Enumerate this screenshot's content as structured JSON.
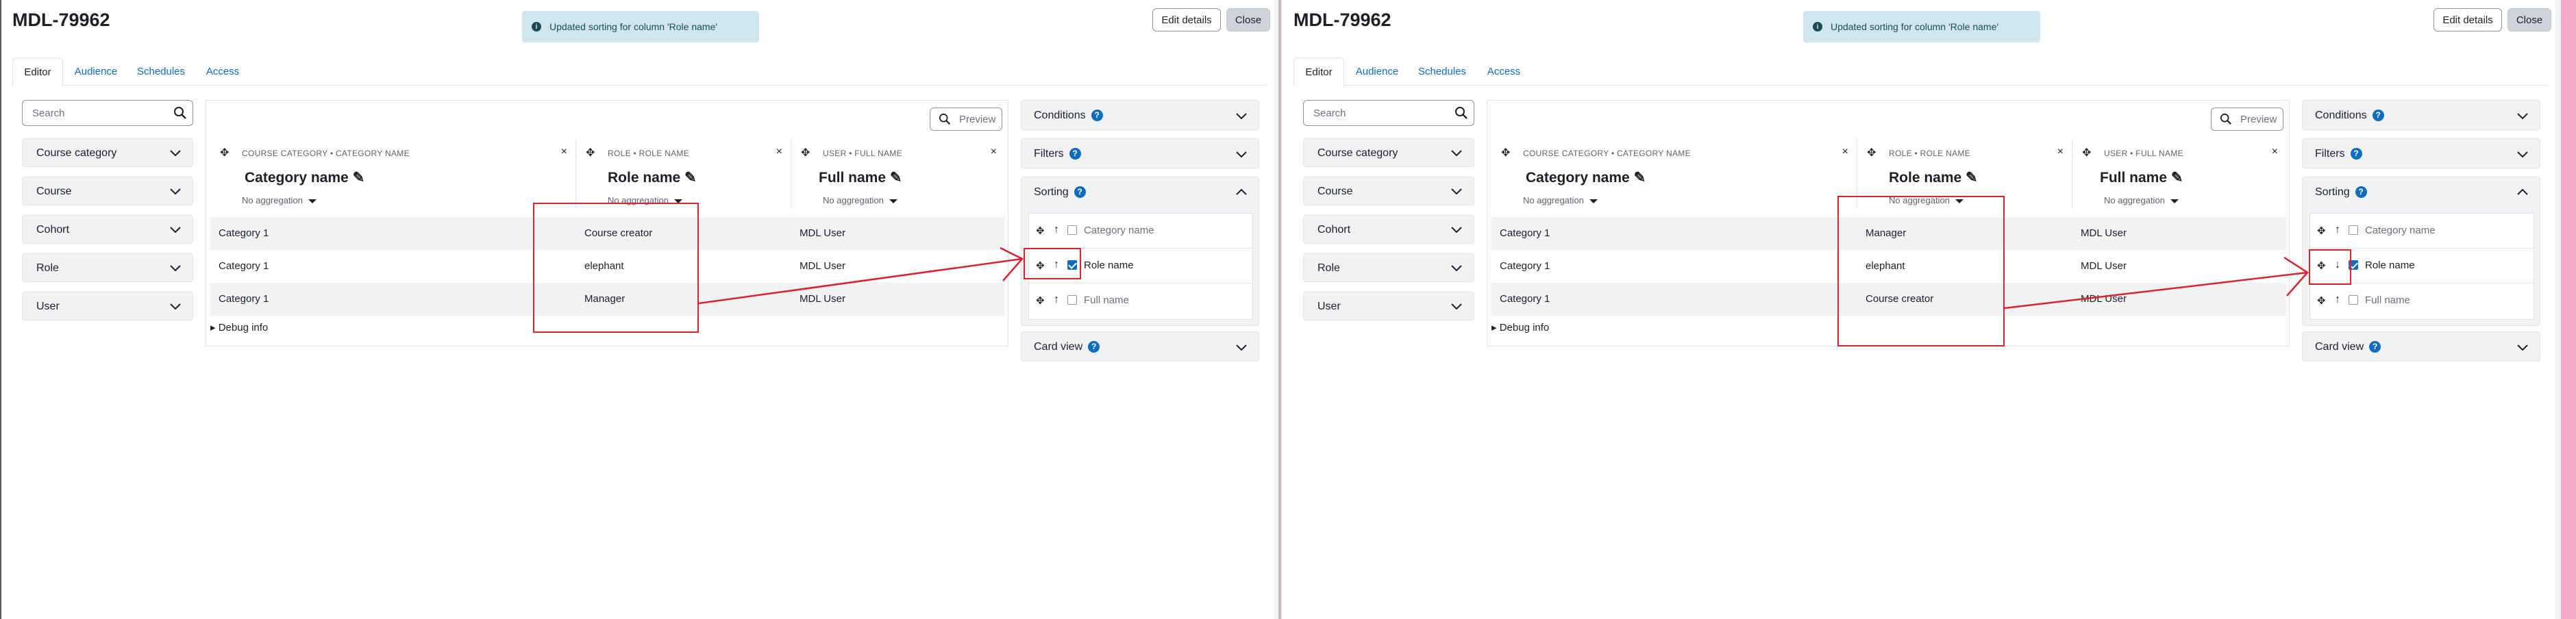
{
  "panels": [
    {
      "title": "MDL-79962",
      "toast": "Updated sorting for column 'Role name'",
      "edit_label": "Edit details",
      "close_label": "Close",
      "tabs": [
        "Editor",
        "Audience",
        "Schedules",
        "Access"
      ],
      "search_placeholder": "Search",
      "sidebar": [
        "Course category",
        "Course",
        "Cohort",
        "Role",
        "User"
      ],
      "preview_label": "Preview",
      "columns": [
        {
          "source": "COURSE CATEGORY • CATEGORY NAME",
          "name": "Category name",
          "agg": "No aggregation"
        },
        {
          "source": "ROLE • ROLE NAME",
          "name": "Role name",
          "agg": "No aggregation"
        },
        {
          "source": "USER • FULL NAME",
          "name": "Full name",
          "agg": "No aggregation"
        }
      ],
      "rows": [
        [
          "Category 1",
          "Course creator",
          "MDL User"
        ],
        [
          "Category 1",
          "elephant",
          "MDL User"
        ],
        [
          "Category 1",
          "Manager",
          "MDL User"
        ]
      ],
      "debug": "Debug info",
      "right": {
        "conditions": "Conditions",
        "filters": "Filters",
        "sorting": "Sorting",
        "card_view": "Card view",
        "sort_items": [
          {
            "label": "Category name",
            "checked": false,
            "dir": "↑"
          },
          {
            "label": "Role name",
            "checked": true,
            "dir": "↑"
          },
          {
            "label": "Full name",
            "checked": false,
            "dir": "↑"
          }
        ]
      }
    },
    {
      "title": "MDL-79962",
      "toast": "Updated sorting for column 'Role name'",
      "edit_label": "Edit details",
      "close_label": "Close",
      "tabs": [
        "Editor",
        "Audience",
        "Schedules",
        "Access"
      ],
      "search_placeholder": "Search",
      "sidebar": [
        "Course category",
        "Course",
        "Cohort",
        "Role",
        "User"
      ],
      "preview_label": "Preview",
      "columns": [
        {
          "source": "COURSE CATEGORY • CATEGORY NAME",
          "name": "Category name",
          "agg": "No aggregation"
        },
        {
          "source": "ROLE • ROLE NAME",
          "name": "Role name",
          "agg": "No aggregation"
        },
        {
          "source": "USER • FULL NAME",
          "name": "Full name",
          "agg": "No aggregation"
        }
      ],
      "rows": [
        [
          "Category 1",
          "Manager",
          "MDL User"
        ],
        [
          "Category 1",
          "elephant",
          "MDL User"
        ],
        [
          "Category 1",
          "Course creator",
          "MDL User"
        ]
      ],
      "debug": "Debug info",
      "right": {
        "conditions": "Conditions",
        "filters": "Filters",
        "sorting": "Sorting",
        "card_view": "Card view",
        "sort_items": [
          {
            "label": "Category name",
            "checked": false,
            "dir": "↑"
          },
          {
            "label": "Role name",
            "checked": true,
            "dir": "↓"
          },
          {
            "label": "Full name",
            "checked": false,
            "dir": "↑"
          }
        ]
      }
    }
  ],
  "colors": {
    "accent": "#0f6cbf",
    "annotation": "#d9232e",
    "toast_bg": "#cfe6ec"
  }
}
